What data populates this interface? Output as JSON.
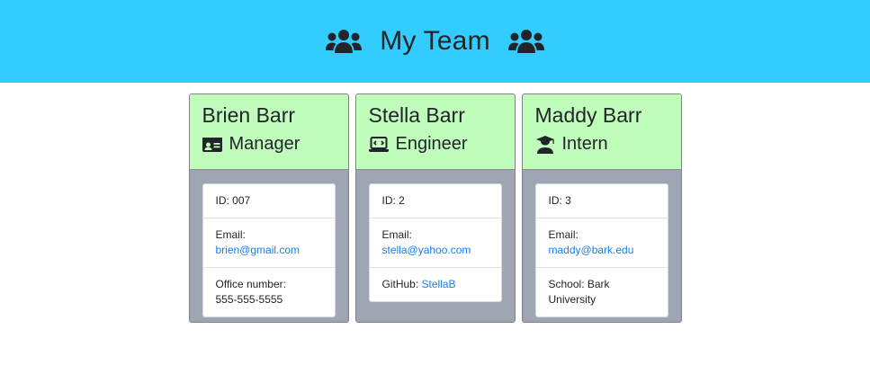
{
  "header": {
    "title": "My Team",
    "icon_left": "users-icon",
    "icon_right": "users-icon"
  },
  "colors": {
    "header_bg": "#33ccff",
    "card_head_bg": "#c0fdbb",
    "card_body_bg": "#9fa5b3",
    "link": "#1a7fe6"
  },
  "cards": [
    {
      "name": "Brien Barr",
      "role": "Manager",
      "role_icon": "id-card-icon",
      "id_label": "ID: 007",
      "email_label": "Email:",
      "email": "brien@gmail.com",
      "extra_label": "Office number:",
      "extra_value": "555-555-5555"
    },
    {
      "name": "Stella Barr",
      "role": "Engineer",
      "role_icon": "laptop-code-icon",
      "id_label": "ID: 2",
      "email_label": "Email:",
      "email": "stella@yahoo.com",
      "extra_label": "GitHub: ",
      "extra_value": "StellaB"
    },
    {
      "name": "Maddy Barr",
      "role": "Intern",
      "role_icon": "user-graduate-icon",
      "id_label": "ID: 3",
      "email_label": "Email:",
      "email": "maddy@bark.edu",
      "extra_label": "School: Bark University"
    }
  ]
}
